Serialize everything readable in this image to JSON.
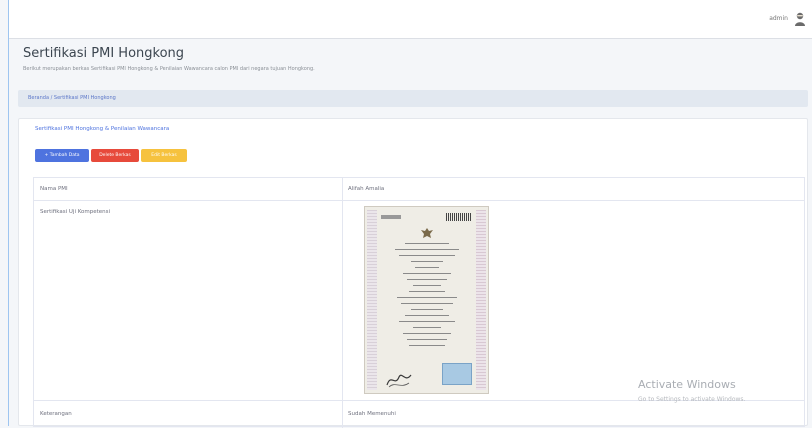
{
  "header": {
    "user_name": "admin"
  },
  "page": {
    "title": "Sertifikasi PMI Hongkong",
    "subtitle": "Berikut merupakan berkas Sertifikasi PMI Hongkong & Penilaian Wawancara calon PMI dari negara tujuan Hongkong."
  },
  "breadcrumb": "Beranda / Sertifikasi PMI Hongkong",
  "card": {
    "title": "Sertifikasi PMI Hongkong & Penilaian Wawancara",
    "buttons": {
      "add": "+ Tambah Data",
      "delete": "Delete Berkas",
      "edit": "Edit Berkas"
    }
  },
  "table": {
    "rows": [
      {
        "label": "Nama PMI",
        "value": "Alifah Amalia"
      },
      {
        "label": "Sertifikasi Uji Kompetensi",
        "value": ""
      },
      {
        "label": "Keterangan",
        "value": "Sudah Memenuhi"
      }
    ]
  },
  "watermark": {
    "title": "Activate Windows",
    "subtitle": "Go to Settings to activate Windows."
  }
}
